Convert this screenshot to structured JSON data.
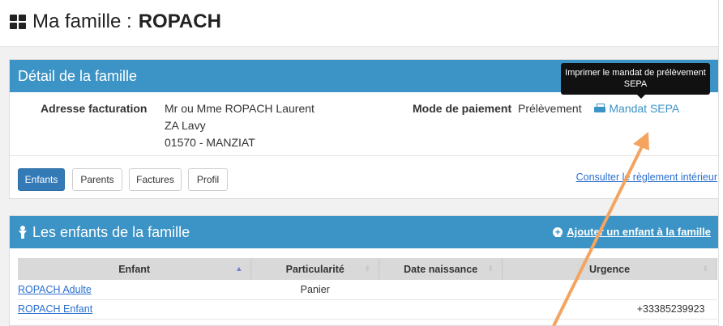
{
  "page": {
    "title_prefix": "Ma famille :",
    "family_name": "ROPACH"
  },
  "detail_panel": {
    "title": "Détail de la famille",
    "billing_label": "Adresse facturation",
    "billing_line1": "Mr ou Mme ROPACH Laurent",
    "billing_line2": "ZA Lavy",
    "billing_line3": "01570 - MANZIAT",
    "payment_label": "Mode de paiement",
    "payment_value": "Prélèvement",
    "sepa_link": "Mandat SEPA",
    "tooltip": "Imprimer le mandat de prélèvement SEPA",
    "tabs": [
      "Enfants",
      "Parents",
      "Factures",
      "Profil"
    ],
    "rules_link": "Consulter le règlement intérieur"
  },
  "children_panel": {
    "title": "Les enfants de la famille",
    "add_link": "Ajouter un enfant à la famille",
    "columns": [
      "Enfant",
      "Particularité",
      "Date naissance",
      "Urgence"
    ],
    "rows": [
      {
        "enfant": "ROPACH Adulte",
        "particularite": "Panier",
        "naissance": "",
        "urgence": ""
      },
      {
        "enfant": "ROPACH Enfant",
        "particularite": "",
        "naissance": "",
        "urgence": "+33385239923"
      }
    ]
  },
  "colors": {
    "panel_header": "#3c93c5",
    "annotation_arrow": "#f4a460",
    "tab_active": "#337ab7"
  }
}
